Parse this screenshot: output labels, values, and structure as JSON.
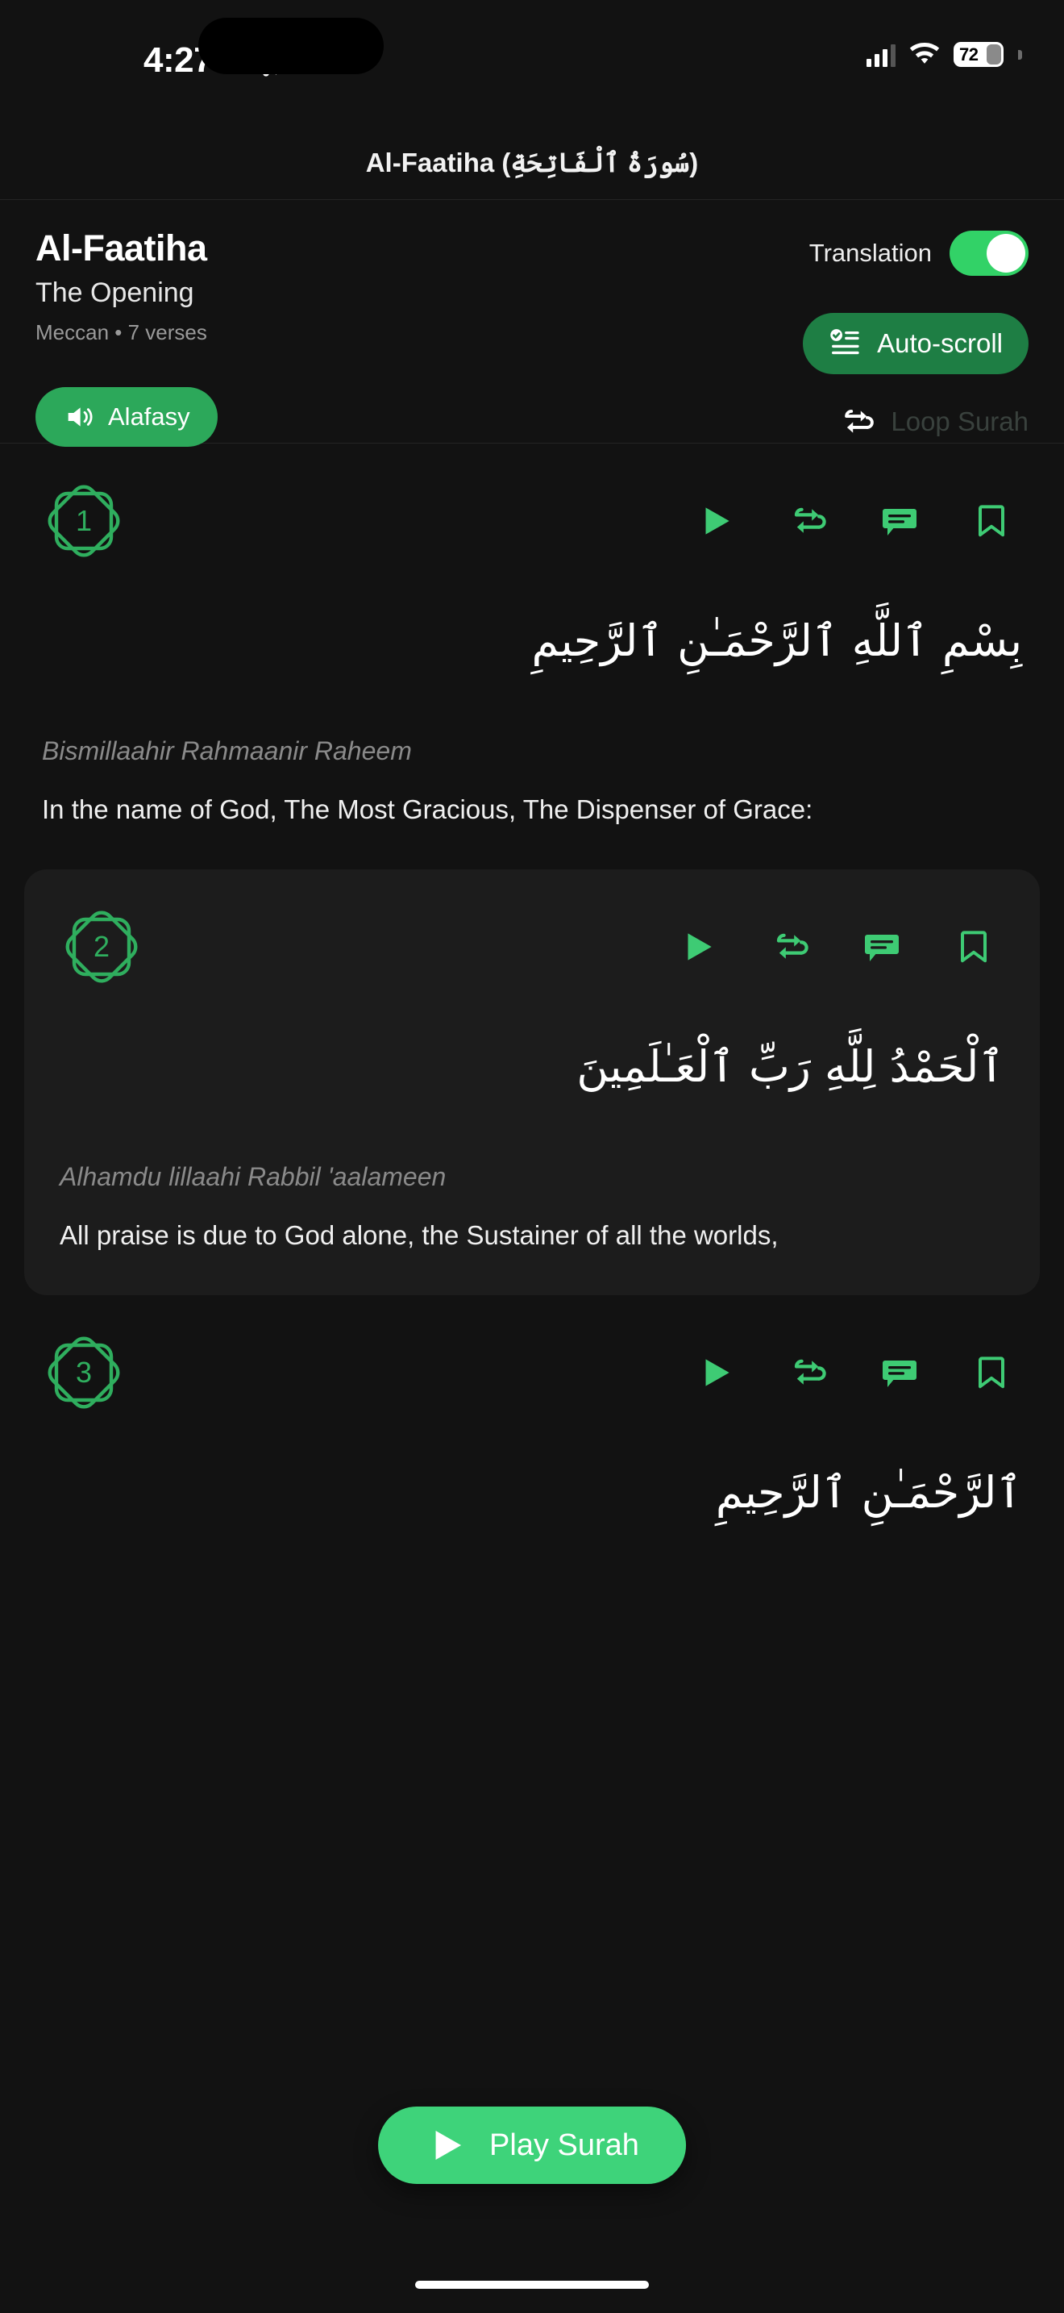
{
  "status_bar": {
    "time": "4:27",
    "battery_percent": "72",
    "icons": [
      "bell-off-icon",
      "cellular-signal-icon",
      "wifi-icon",
      "battery-icon"
    ]
  },
  "navbar": {
    "title": "Al-Faatiha (سُورَةُ ٱلْفَاتِحَةِ)"
  },
  "surah_header": {
    "name": "Al-Faatiha",
    "english_name": "The Opening",
    "meta": "Meccan • 7 verses",
    "reciter_label": "Alafasy",
    "translation_label": "Translation",
    "translation_enabled": true,
    "autoscroll_label": "Auto-scroll",
    "loop_label": "Loop Surah",
    "loop_enabled": false
  },
  "verse_actions": [
    "play-icon",
    "repeat-icon",
    "comment-icon",
    "bookmark-icon"
  ],
  "verses": [
    {
      "number": "1",
      "arabic": "بِسْمِ ٱللَّهِ ٱلرَّحْمَـٰنِ ٱلرَّحِيمِ",
      "transliteration": "Bismillaahir Rahmaanir Raheem",
      "translation": "In the name of God, The Most Gracious, The Dispenser of Grace:"
    },
    {
      "number": "2",
      "arabic": "ٱلْحَمْدُ لِلَّهِ رَبِّ ٱلْعَـٰلَمِينَ",
      "transliteration": "Alhamdu lillaahi Rabbil 'aalameen",
      "translation": "All praise is due to God alone, the Sustainer of all the worlds,"
    },
    {
      "number": "3",
      "arabic": "ٱلرَّحْمَـٰنِ ٱلرَّحِيمِ",
      "transliteration": "",
      "translation": ""
    }
  ],
  "play_fab": {
    "label": "Play Surah"
  },
  "colors": {
    "accent_green": "#2FAE5E",
    "bright_green": "#3ED37A",
    "toggle_green": "#32D267",
    "autoscroll_green": "#1E7E44",
    "background": "#121212",
    "card": "#1C1C1C",
    "muted_text": "#8a8a8a",
    "disabled_text": "#39413D"
  }
}
